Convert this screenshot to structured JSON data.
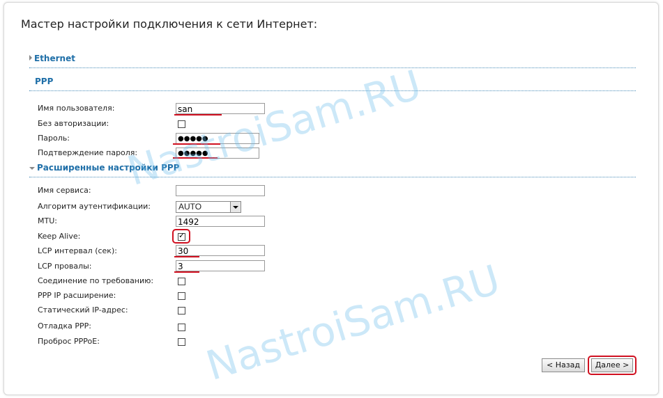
{
  "page_title": "Мастер настройки подключения к сети Интернет:",
  "sections": {
    "ethernet": "Ethernet",
    "ppp": "PPP",
    "ppp_advanced": "Расширенные настройки PPP"
  },
  "ppp": {
    "username_label": "Имя пользователя:",
    "username_value": "san",
    "no_auth_label": "Без авторизации:",
    "password_label": "Пароль:",
    "password_value": "●●●●●",
    "confirm_label": "Подтверждение пароля:",
    "confirm_value": "●●●●●"
  },
  "advanced": {
    "service_label": "Имя сервиса:",
    "service_value": "",
    "auth_label": "Алгоритм аутентификации:",
    "auth_value": "AUTO",
    "mtu_label": "MTU:",
    "mtu_value": "1492",
    "keepalive_label": "Keep Alive:",
    "lcp_interval_label": "LCP интервал (сек):",
    "lcp_interval_value": "30",
    "lcp_fails_label": "LCP провалы:",
    "lcp_fails_value": "3",
    "on_demand_label": "Соединение по требованию:",
    "ppp_ip_ext_label": "PPP IP расширение:",
    "static_ip_label": "Статический IP-адрес:",
    "debug_label": "Отладка PPP:",
    "pppoe_passthrough_label": "Проброс PPPoE:"
  },
  "buttons": {
    "back": "< Назад",
    "next": "Далее >"
  },
  "watermark": "NastroiSam.RU",
  "colors": {
    "section_text": "#1f6fa8",
    "highlight": "#d01020"
  }
}
